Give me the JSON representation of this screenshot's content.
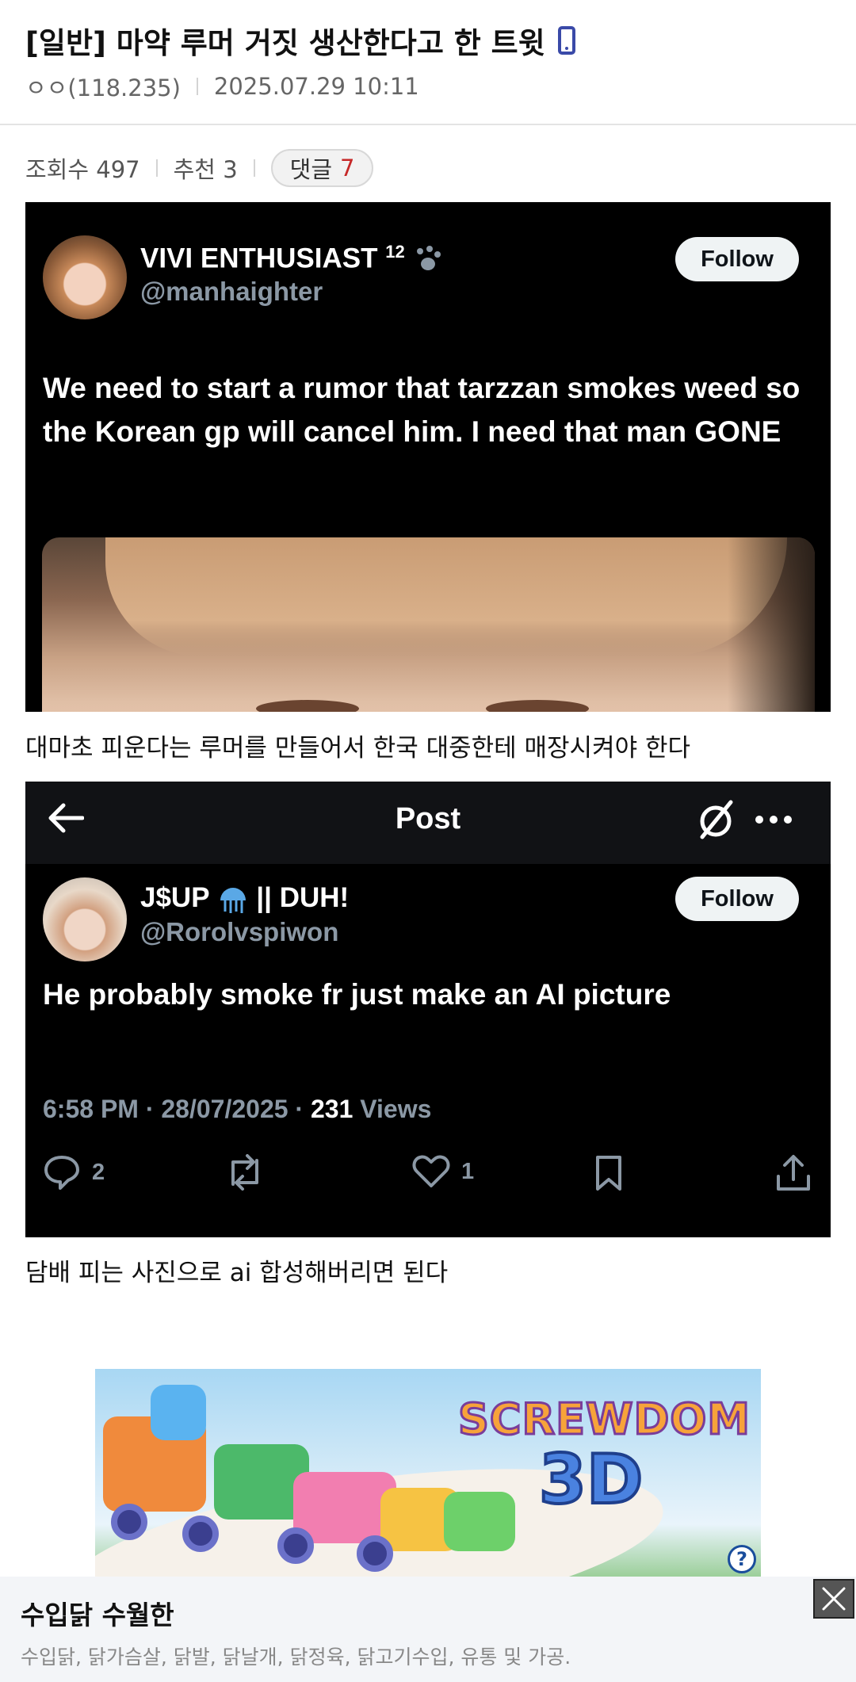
{
  "post": {
    "title": "[일반] 마약 루머 거짓 생산한다고 한 트윗",
    "author": "ㅇㅇ(118.235)",
    "datetime": "2025.07.29 10:11",
    "views_label": "조회수 497",
    "recommend_label": "추천 3",
    "comments_label": "댓글",
    "comments_count": "7"
  },
  "tweet1": {
    "display_name": "VIVI ENTHUSIAST",
    "badge": "12",
    "handle": "@manhaighter",
    "follow_label": "Follow",
    "text": "We need to start a rumor that tarzzan smokes weed so the Korean gp will cancel him. I need that man GONE"
  },
  "caption1": "대마초 피운다는 루머를 만들어서 한국 대중한테 매장시켜야 한다",
  "tweet2": {
    "header_title": "Post",
    "display_name": "J$UP",
    "display_name_suffix": "|| DUH!",
    "handle": "@Rorolvspiwon",
    "follow_label": "Follow",
    "text": "He probably smoke fr just make an AI picture",
    "timestamp": "6:58 PM · 28/07/2025 · ",
    "views_count": "231",
    "views_label": " Views",
    "reply_count": "2",
    "like_count": "1"
  },
  "caption2": "담배 피는 사진으로 ai 합성해버리면 된다",
  "ad": {
    "brand_line1": "SCREWDOM",
    "brand_line2": "3D",
    "info_glyph": "?"
  },
  "bottom_ad": {
    "title": "수입닭 수월한",
    "subtitle": "수입닭, 닭가슴살, 닭발, 닭날개, 닭정육, 닭고기수입, 유통 및 가공."
  },
  "colors": {
    "comment_count": "#c62828",
    "tweet_bg": "#000000",
    "handle_gray": "#8b98a5",
    "phone_icon": "#3a4aa8"
  }
}
